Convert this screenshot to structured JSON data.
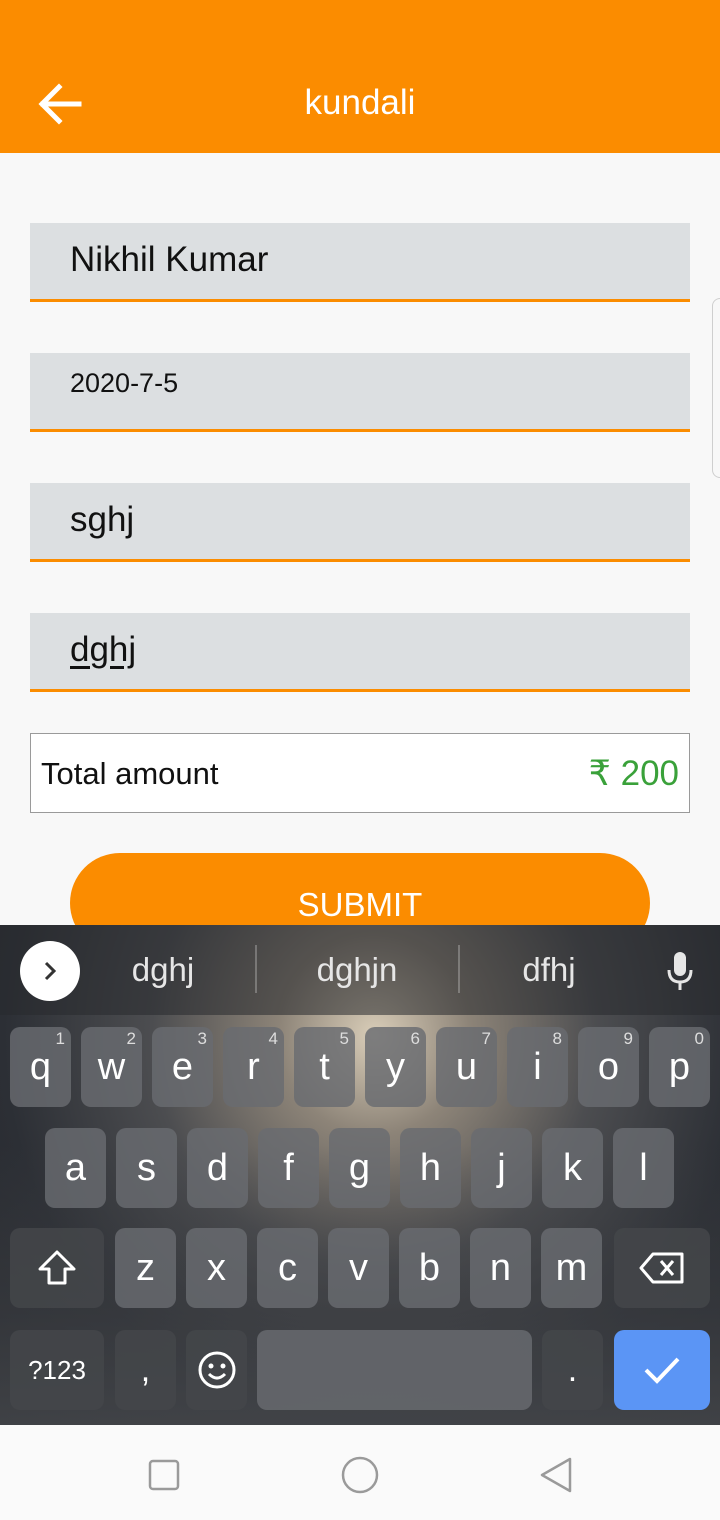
{
  "header": {
    "title": "kundali"
  },
  "form": {
    "name": "Nikhil Kumar",
    "dob": "2020-7-5",
    "field3": "sghj",
    "field4": "dghj"
  },
  "total": {
    "label": "Total amount",
    "amount": "₹ 200"
  },
  "submit_label": "SUBMIT",
  "keyboard": {
    "suggestions": [
      "dghj",
      "dghjn",
      "dfhj"
    ],
    "row1": [
      {
        "k": "q",
        "h": "1"
      },
      {
        "k": "w",
        "h": "2"
      },
      {
        "k": "e",
        "h": "3"
      },
      {
        "k": "r",
        "h": "4"
      },
      {
        "k": "t",
        "h": "5"
      },
      {
        "k": "y",
        "h": "6"
      },
      {
        "k": "u",
        "h": "7"
      },
      {
        "k": "i",
        "h": "8"
      },
      {
        "k": "o",
        "h": "9"
      },
      {
        "k": "p",
        "h": "0"
      }
    ],
    "row2": [
      "a",
      "s",
      "d",
      "f",
      "g",
      "h",
      "j",
      "k",
      "l"
    ],
    "row3": [
      "z",
      "x",
      "c",
      "v",
      "b",
      "n",
      "m"
    ],
    "symbols_label": "?123",
    "comma": ",",
    "period": "."
  },
  "colors": {
    "accent": "#fb8c00",
    "amount": "#3aa13a",
    "enter": "#5b95f5"
  }
}
